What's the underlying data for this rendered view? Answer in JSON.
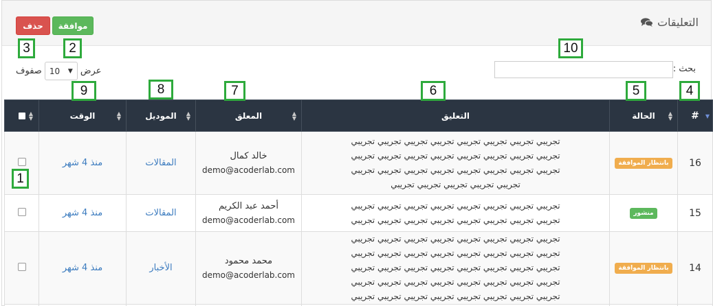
{
  "header": {
    "title": "التعليقات",
    "approve_label": "موافقة",
    "delete_label": "حذف"
  },
  "callouts": [
    "1",
    "2",
    "3",
    "4",
    "5",
    "6",
    "7",
    "8",
    "9",
    "10"
  ],
  "controls": {
    "search_label": "بحث :",
    "search_value": "",
    "show_label": "عرض",
    "rows_label": "صفوف",
    "page_length": "10"
  },
  "table": {
    "columns": {
      "id": "#",
      "status": "الحالة",
      "comment": "التعليق",
      "commenter": "المعلق",
      "module": "الموديل",
      "time": "الوقت"
    },
    "rows": [
      {
        "id": "16",
        "status": "بانتظار الموافقة",
        "status_color": "#f0ad4e",
        "comment_lines": [
          "تجريبي تجريبي تجريبي تجريبي تجريبي تجريبي تجريبي تجريبي",
          "تجريبي تجريبي تجريبي تجريبي تجريبي تجريبي تجريبي تجريبي",
          "تجريبي تجريبي تجريبي تجريبي تجريبي تجريبي تجريبي تجريبي",
          "تجريبي تجريبي تجريبي تجريبي تجريبي"
        ],
        "commenter_name": "خالد كمال",
        "commenter_email": "demo@acoderlab.com",
        "module": "المقالات",
        "time": "منذ 4 شهر"
      },
      {
        "id": "15",
        "status": "منشور",
        "status_color": "#5cb85c",
        "comment_lines": [
          "تجريبي تجريبي تجريبي تجريبي تجريبي تجريبي تجريبي تجريبي",
          "تجريبي تجريبي تجريبي تجريبي تجريبي تجريبي تجريبي تجريبي"
        ],
        "commenter_name": "أحمد عبد الكريم",
        "commenter_email": "demo@acoderlab.com",
        "module": "المقالات",
        "time": "منذ 4 شهر"
      },
      {
        "id": "14",
        "status": "بانتظار الموافقة",
        "status_color": "#f0ad4e",
        "comment_lines": [
          "تجريبي تجريبي تجريبي تجريبي تجريبي تجريبي تجريبي تجريبي",
          "تجريبي تجريبي تجريبي تجريبي تجريبي تجريبي تجريبي تجريبي",
          "تجريبي تجريبي تجريبي تجريبي تجريبي تجريبي تجريبي تجريبي",
          "تجريبي تجريبي تجريبي تجريبي تجريبي تجريبي تجريبي تجريبي",
          "تجريبي تجريبي تجريبي تجريبي تجريبي تجريبي تجريبي تجريبي"
        ],
        "commenter_name": "محمد محمود",
        "commenter_email": "demo@acoderlab.com",
        "module": "الأخبار",
        "time": "منذ 4 شهر"
      }
    ]
  },
  "colors": {
    "header_bg": "#2b3542",
    "approve": "#5cb85c",
    "delete": "#d9534f",
    "callout_border": "#2eaa3c",
    "link": "#3b7bbf"
  },
  "icons": [
    "comments-icon",
    "sort-icon",
    "sort-desc-icon",
    "caret-down-icon"
  ]
}
